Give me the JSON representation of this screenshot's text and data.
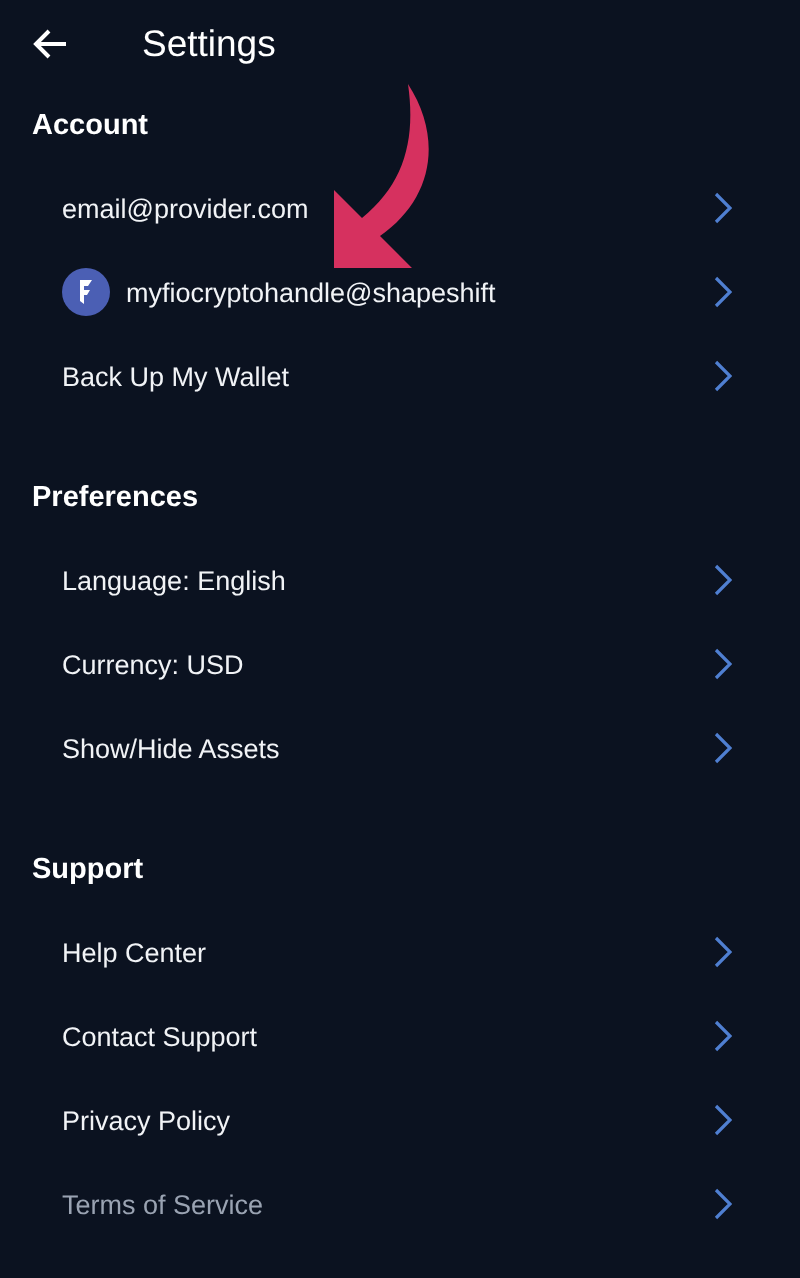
{
  "header": {
    "title": "Settings"
  },
  "sections": [
    {
      "title": "Account",
      "items": [
        {
          "kind": "text",
          "label": "email@provider.com",
          "dimmed": false
        },
        {
          "kind": "avatar",
          "label": "myfiocryptohandle@shapeshift",
          "dimmed": false
        },
        {
          "kind": "text",
          "label": "Back Up My Wallet",
          "dimmed": false
        }
      ]
    },
    {
      "title": "Preferences",
      "items": [
        {
          "kind": "text",
          "label": "Language: English",
          "dimmed": false
        },
        {
          "kind": "text",
          "label": "Currency: USD",
          "dimmed": false
        },
        {
          "kind": "text",
          "label": "Show/Hide Assets",
          "dimmed": false
        }
      ]
    },
    {
      "title": "Support",
      "items": [
        {
          "kind": "text",
          "label": "Help Center",
          "dimmed": false
        },
        {
          "kind": "text",
          "label": "Contact Support",
          "dimmed": false
        },
        {
          "kind": "text",
          "label": "Privacy Policy",
          "dimmed": false
        },
        {
          "kind": "text",
          "label": "Terms of Service",
          "dimmed": true
        }
      ]
    }
  ]
}
